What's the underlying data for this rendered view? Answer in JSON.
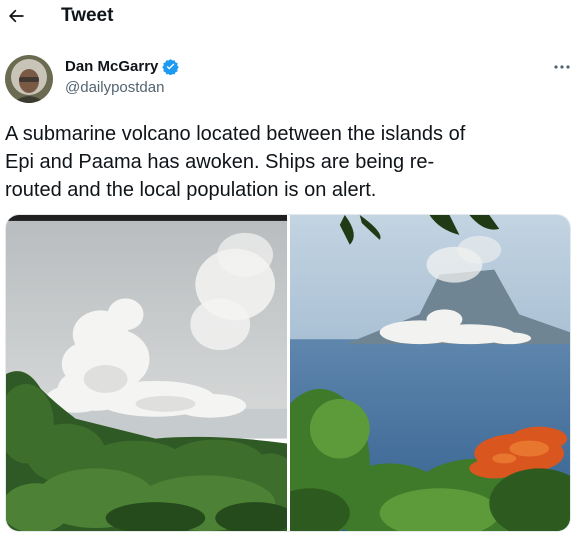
{
  "header": {
    "back_icon": "arrow-left-icon",
    "title": "Tweet"
  },
  "author": {
    "name": "Dan McGarry",
    "handle": "@dailypostdan",
    "verified": true,
    "verified_color": "#1d9bf0"
  },
  "tweet": {
    "text": "A submarine volcano located between the islands of\nEpi and Paama has awoken. Ships are being re-\nrouted and the local population is on alert."
  },
  "media": {
    "count": 2,
    "items": [
      {
        "depicts": "volcano-eruption-cloud-over-sea-with-jungle-foreground"
      },
      {
        "depicts": "volcanic-island-plume-over-blue-sea-with-flowering-tree-foreground"
      }
    ]
  },
  "icons": {
    "more": "more-horizontal-icon",
    "verified": "verified-badge-icon"
  }
}
